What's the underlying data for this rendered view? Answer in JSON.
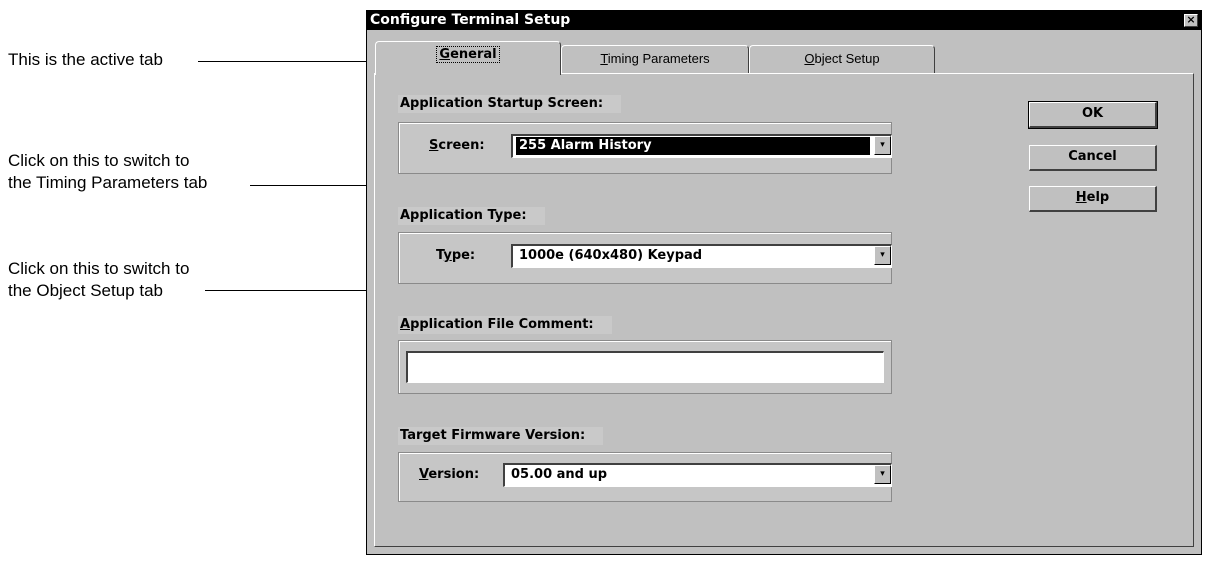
{
  "callouts": {
    "active_tab": "This is the active tab",
    "timing_line1": "Click on this to switch to",
    "timing_line2": "the Timing Parameters tab",
    "object_line1": "Click on this to switch to",
    "object_line2": "the Object Setup tab"
  },
  "window": {
    "title": "Configure Terminal Setup",
    "close_glyph": "×"
  },
  "tabs": [
    {
      "label": "General",
      "accel": "G",
      "rest": "eneral",
      "active": true
    },
    {
      "label": "Timing Parameters",
      "accel": "T",
      "rest": "iming Parameters",
      "active": false
    },
    {
      "label": "Object Setup",
      "accel": "O",
      "rest": "bject Setup",
      "active": false
    }
  ],
  "startup": {
    "group_label": "Application Startup Screen:",
    "field_accel": "S",
    "field_rest": "creen:",
    "value": "255 Alarm History"
  },
  "app_type": {
    "group_label": "Application Type:",
    "field_pre": "T",
    "field_accel": "y",
    "field_rest": "pe:",
    "value": "1000e (640x480) Keypad"
  },
  "comment": {
    "label_accel": "A",
    "label_rest": "pplication File Comment:",
    "value": ""
  },
  "firmware": {
    "group_label": "Target Firmware Version:",
    "field_accel": "V",
    "field_rest": "ersion:",
    "value": "05.00 and up"
  },
  "buttons": {
    "ok": "OK",
    "cancel": "Cancel",
    "help_accel": "H",
    "help_rest": "elp"
  },
  "icons": {
    "dropdown": "combo-dropdown-arrow-icon",
    "close": "close-icon"
  }
}
